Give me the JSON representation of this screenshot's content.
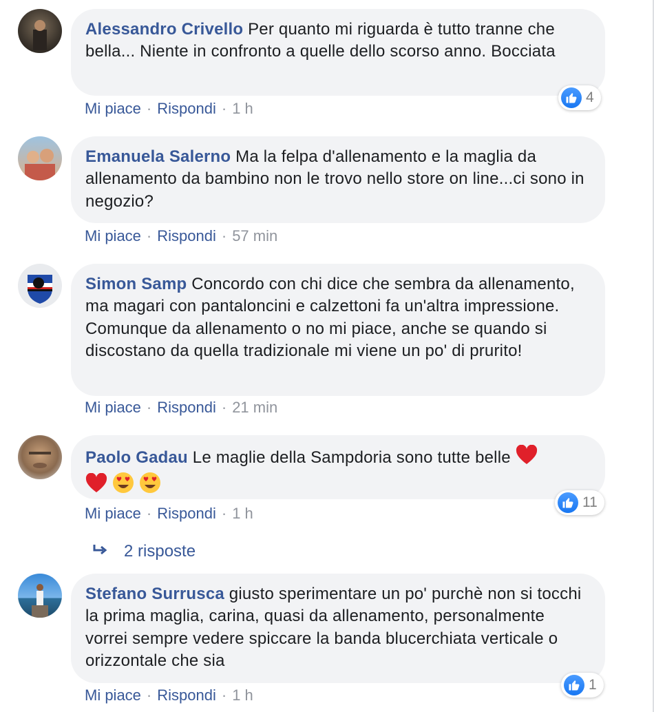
{
  "comments": [
    {
      "author": "Alessandro Crivello",
      "text": " Per quanto mi riguarda è tutto tranne che bella... Niente in confronto a quelle dello scorso anno. Bocciata",
      "like_label": "Mi piace",
      "reply_label": "Rispondi",
      "time": "1 h",
      "reactions": "4"
    },
    {
      "author": "Emanuela Salerno",
      "text": " Ma la felpa d'allenamento e la maglia da allenamento da bambino non le trovo nello store on line...ci sono in negozio?",
      "like_label": "Mi piace",
      "reply_label": "Rispondi",
      "time": "57 min"
    },
    {
      "author": "Simon Samp",
      "text": " Concordo con chi dice che sembra da allenamento, ma magari con pantaloncini e calzettoni fa un'altra impressione. Comunque da allenamento o no mi piace, anche se quando si discostano da quella tradizionale mi viene un po' di prurito!",
      "like_label": "Mi piace",
      "reply_label": "Rispondi",
      "time": "21 min"
    },
    {
      "author": "Paolo Gadau",
      "text": " Le maglie della Sampdoria sono tutte belle ",
      "like_label": "Mi piace",
      "reply_label": "Rispondi",
      "time": "1 h",
      "reactions": "11",
      "replies": "2 risposte"
    },
    {
      "author": "Stefano Surrusca",
      "text": " giusto sperimentare un po' purchè non si tocchi la prima maglia, carina, quasi da allenamento, personalmente vorrei sempre vedere spiccare la banda blucerchiata verticale o orizzontale che sia",
      "like_label": "Mi piace",
      "reply_label": "Rispondi",
      "time": "1 h",
      "reactions": "1"
    }
  ],
  "separator": "·",
  "colors": {
    "link": "#385898",
    "bubble": "#f2f3f5",
    "meta": "#90949c",
    "like_blue": "#1877f2"
  }
}
